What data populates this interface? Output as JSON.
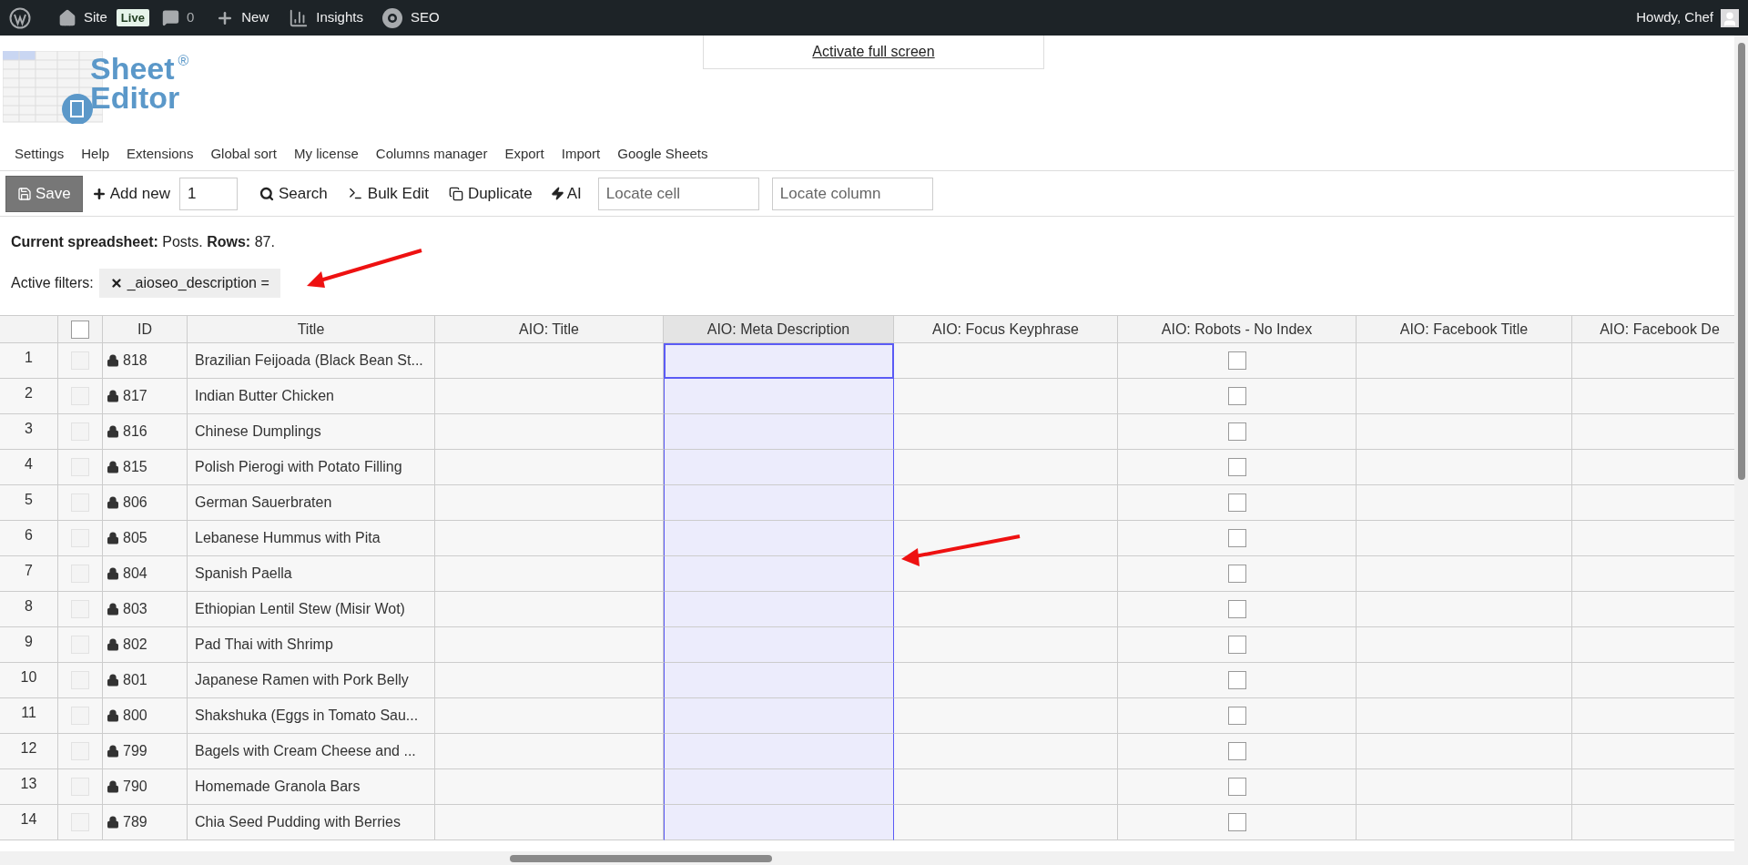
{
  "admin_bar": {
    "site": "Site",
    "badge": "Live",
    "comments": "0",
    "new": "New",
    "insights": "Insights",
    "seo": "SEO",
    "howdy": "Howdy, Chef"
  },
  "fullscreen_link": "Activate full screen",
  "logo": {
    "line_1": "Sheet",
    "line_2": "Editor",
    "mark": "®"
  },
  "menu": [
    "Settings",
    "Help",
    "Extensions",
    "Global sort",
    "My license",
    "Columns manager",
    "Export",
    "Import",
    "Google Sheets"
  ],
  "toolbar": {
    "save": "Save",
    "add_new": "Add new",
    "quantity": "1",
    "search": "Search",
    "bulk_edit": "Bulk Edit",
    "duplicate": "Duplicate",
    "ai": "AI",
    "locate_cell": {
      "placeholder": "Locate cell"
    },
    "locate_column": {
      "placeholder": "Locate column"
    }
  },
  "info": "**Current spreadsheet:** Posts. **Rows:** 87.",
  "filters": {
    "label": "Active filters:",
    "chips": [
      "_aioseo_description ="
    ]
  },
  "table": {
    "header_checked": false,
    "columns": [
      {
        "kind": "row_number",
        "selected": false
      },
      {
        "kind": "checkbox",
        "selected": false
      },
      {
        "kind": "id",
        "label": "ID",
        "selected": false
      },
      {
        "kind": "title",
        "label": "Title",
        "selected": false
      },
      {
        "kind": "empty",
        "label": "AIO: Title",
        "selected": false
      },
      {
        "kind": "empty",
        "label": "AIO: Meta Description",
        "selected": true
      },
      {
        "kind": "empty",
        "label": "AIO: Focus Keyphrase",
        "selected": false
      },
      {
        "kind": "toggle",
        "label": "AIO: Robots - No Index",
        "selected": false
      },
      {
        "kind": "empty",
        "label": "AIO: Facebook Title",
        "selected": false
      },
      {
        "kind": "empty",
        "label": "AIO: Facebook De",
        "selected": false
      }
    ],
    "rows": [
      {
        "number": "1",
        "checked": false,
        "id": "818",
        "locked": true,
        "title": "Brazilian Feijoada (Black Bean St...",
        "no_index": false,
        "focused": true
      },
      {
        "number": "2",
        "checked": false,
        "id": "817",
        "locked": true,
        "title": "Indian Butter Chicken",
        "no_index": false,
        "focused": false
      },
      {
        "number": "3",
        "checked": false,
        "id": "816",
        "locked": true,
        "title": "Chinese Dumplings",
        "no_index": false,
        "focused": false
      },
      {
        "number": "4",
        "checked": false,
        "id": "815",
        "locked": true,
        "title": "Polish Pierogi with Potato Filling",
        "no_index": false,
        "focused": false
      },
      {
        "number": "5",
        "checked": false,
        "id": "806",
        "locked": true,
        "title": "German Sauerbraten",
        "no_index": false,
        "focused": false
      },
      {
        "number": "6",
        "checked": false,
        "id": "805",
        "locked": true,
        "title": "Lebanese Hummus with Pita",
        "no_index": false,
        "focused": false
      },
      {
        "number": "7",
        "checked": false,
        "id": "804",
        "locked": true,
        "title": "Spanish Paella",
        "no_index": false,
        "focused": false
      },
      {
        "number": "8",
        "checked": false,
        "id": "803",
        "locked": true,
        "title": "Ethiopian Lentil Stew (Misir Wot)",
        "no_index": false,
        "focused": false
      },
      {
        "number": "9",
        "checked": false,
        "id": "802",
        "locked": true,
        "title": "Pad Thai with Shrimp",
        "no_index": false,
        "focused": false
      },
      {
        "number": "10",
        "checked": false,
        "id": "801",
        "locked": true,
        "title": "Japanese Ramen with Pork Belly",
        "no_index": false,
        "focused": false
      },
      {
        "number": "11",
        "checked": false,
        "id": "800",
        "locked": true,
        "title": "Shakshuka (Eggs in Tomato Sau...",
        "no_index": false,
        "focused": false
      },
      {
        "number": "12",
        "checked": false,
        "id": "799",
        "locked": true,
        "title": "Bagels with Cream Cheese and ...",
        "no_index": false,
        "focused": false
      },
      {
        "number": "13",
        "checked": false,
        "id": "790",
        "locked": true,
        "title": "Homemade Granola Bars",
        "no_index": false,
        "focused": false
      },
      {
        "number": "14",
        "checked": false,
        "id": "789",
        "locked": true,
        "title": "Chia Seed Pudding with Berries",
        "no_index": false,
        "focused": false
      }
    ]
  }
}
